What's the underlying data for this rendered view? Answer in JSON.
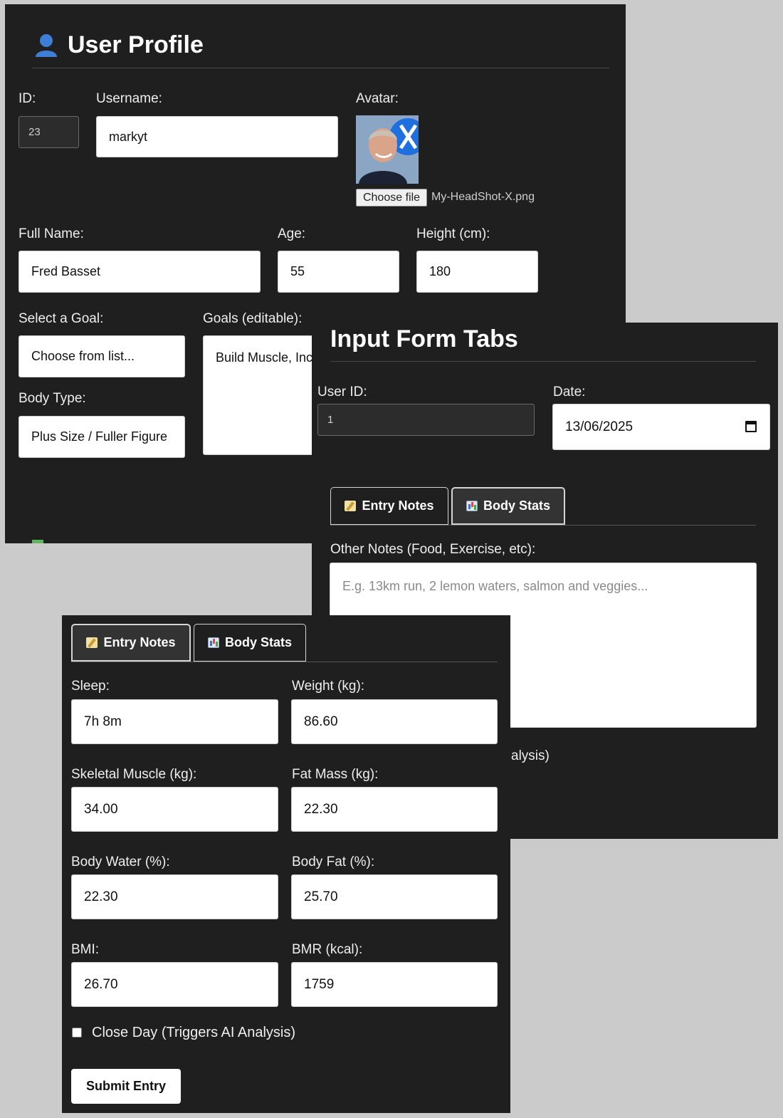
{
  "profile": {
    "title": "User Profile",
    "id_label": "ID:",
    "id_value": "23",
    "username_label": "Username:",
    "username_value": "markyt",
    "avatar_label": "Avatar:",
    "choose_file_label": "Choose file",
    "file_name": "My-HeadShot-X.png",
    "fullname_label": "Full Name:",
    "fullname_value": "Fred Basset",
    "age_label": "Age:",
    "age_value": "55",
    "height_label": "Height (cm):",
    "height_value": "180",
    "goal_select_label": "Select a Goal:",
    "goal_select_value": "Choose from list...",
    "goals_label": "Goals (editable):",
    "goals_value": "Build Muscle, Inc",
    "bodytype_label": "Body Type:",
    "bodytype_value": "Plus Size / Fuller Figure"
  },
  "tabs_form": {
    "title": "Input Form Tabs",
    "userid_label": "User ID:",
    "userid_value": "1",
    "date_label": "Date:",
    "date_value": "13/06/2025",
    "tab_entry_notes": "Entry Notes",
    "tab_body_stats": "Body Stats",
    "notes_label": "Other Notes (Food, Exercise, etc):",
    "notes_placeholder": "E.g. 13km run, 2 lemon waters, salmon and veggies...",
    "partial_text": "alysis)"
  },
  "stats_form": {
    "tab_entry_notes": "Entry Notes",
    "tab_body_stats": "Body Stats",
    "sleep_label": "Sleep:",
    "sleep_value": "7h 8m",
    "weight_label": "Weight (kg):",
    "weight_value": "86.60",
    "muscle_label": "Skeletal Muscle (kg):",
    "muscle_value": "34.00",
    "fatmass_label": "Fat Mass (kg):",
    "fatmass_value": "22.30",
    "water_label": "Body Water (%):",
    "water_value": "22.30",
    "bodyfat_label": "Body Fat (%):",
    "bodyfat_value": "25.70",
    "bmi_label": "BMI:",
    "bmi_value": "26.70",
    "bmr_label": "BMR (kcal):",
    "bmr_value": "1759",
    "close_day_label": "Close Day (Triggers AI Analysis)",
    "submit_label": "Submit Entry"
  },
  "colors": {
    "panel": "#1f1f1f",
    "background": "#cbcbcb",
    "accent_check": "#5cb85c"
  }
}
